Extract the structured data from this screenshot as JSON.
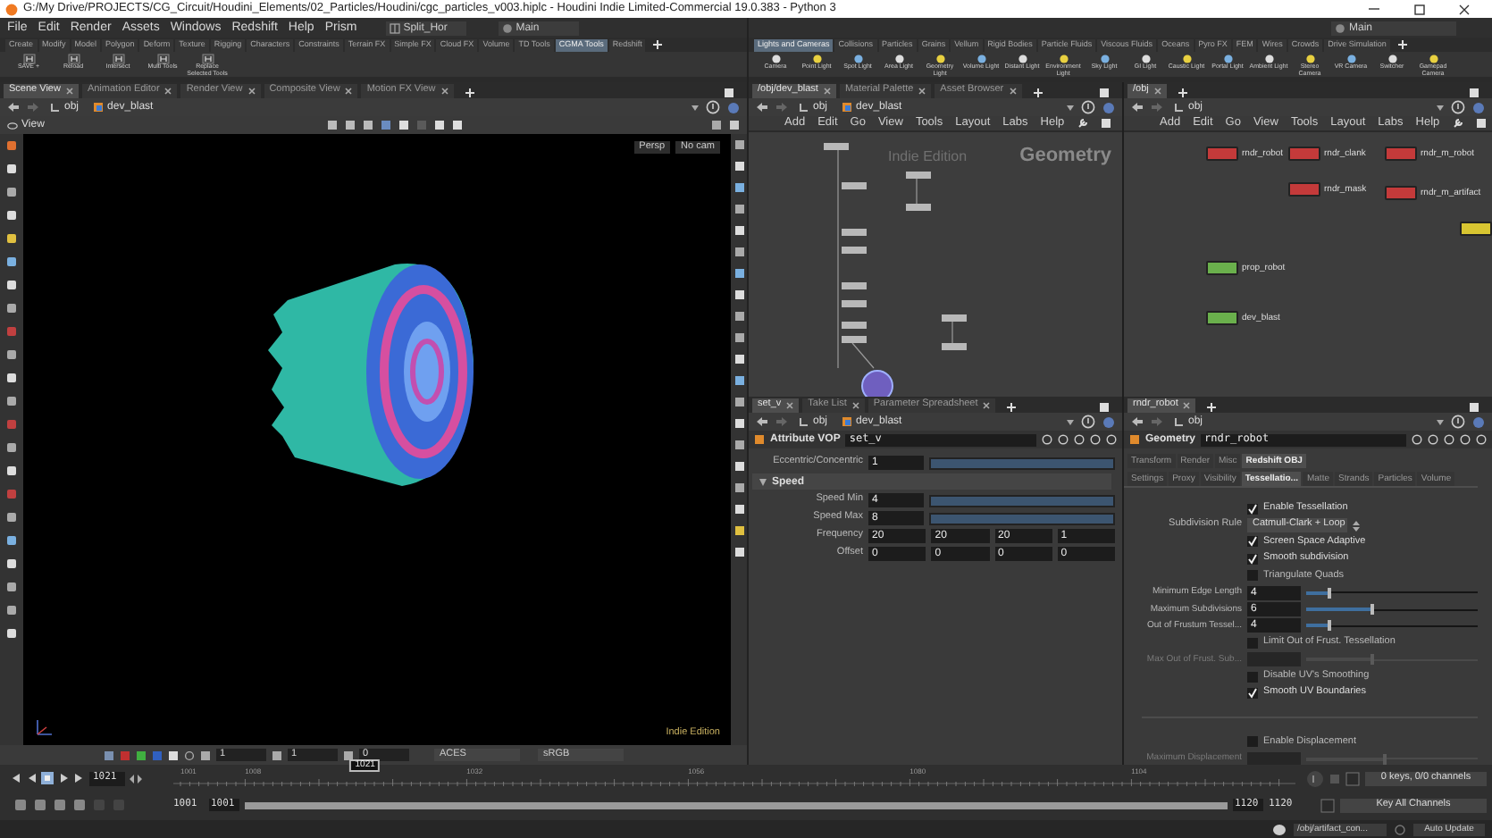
{
  "window": {
    "title": "G:/My Drive/PROJECTS/CG_Circuit/Houdini_Elements/02_Particles/Houdini/cgc_particles_v003.hiplc - Houdini Indie Limited-Commercial 19.0.383 - Python 3"
  },
  "menu": [
    "File",
    "Edit",
    "Render",
    "Assets",
    "Windows",
    "Redshift",
    "Help",
    "Prism"
  ],
  "desktop": "Split_Hor",
  "desktop_main": "Main",
  "desktop_main_right": "Main",
  "shelf_left": {
    "tabs": [
      {
        "label": "Create",
        "selected": false
      },
      {
        "label": "Modify",
        "selected": false
      },
      {
        "label": "Model",
        "selected": false
      },
      {
        "label": "Polygon",
        "selected": false
      },
      {
        "label": "Deform",
        "selected": false
      },
      {
        "label": "Texture",
        "selected": false
      },
      {
        "label": "Rigging",
        "selected": false
      },
      {
        "label": "Characters",
        "selected": false
      },
      {
        "label": "Constraints",
        "selected": false
      },
      {
        "label": "Terrain FX",
        "selected": false
      },
      {
        "label": "Simple FX",
        "selected": false
      },
      {
        "label": "Cloud FX",
        "selected": false
      },
      {
        "label": "Volume",
        "selected": false
      },
      {
        "label": "TD Tools",
        "selected": false
      },
      {
        "label": "CGMA Tools",
        "selected": true
      },
      {
        "label": "Redshift",
        "selected": false
      }
    ],
    "tools": [
      "SAVE +",
      "Reload",
      "Intersect",
      "Multi Tools",
      "Replace Selected Tools"
    ]
  },
  "shelf_right": {
    "tabs": [
      {
        "label": "Lights and Cameras",
        "selected": true
      },
      {
        "label": "Collisions",
        "selected": false
      },
      {
        "label": "Particles",
        "selected": false
      },
      {
        "label": "Grains",
        "selected": false
      },
      {
        "label": "Vellum",
        "selected": false
      },
      {
        "label": "Rigid Bodies",
        "selected": false
      },
      {
        "label": "Particle Fluids",
        "selected": false
      },
      {
        "label": "Viscous Fluids",
        "selected": false
      },
      {
        "label": "Oceans",
        "selected": false
      },
      {
        "label": "Pyro FX",
        "selected": false
      },
      {
        "label": "FEM",
        "selected": false
      },
      {
        "label": "Wires",
        "selected": false
      },
      {
        "label": "Crowds",
        "selected": false
      },
      {
        "label": "Drive Simulation",
        "selected": false
      }
    ],
    "tools": [
      "Camera",
      "Point Light",
      "Spot Light",
      "Area Light",
      "Geometry Light",
      "Volume Light",
      "Distant Light",
      "Environment Light",
      "Sky Light",
      "GI Light",
      "Caustic Light",
      "Portal Light",
      "Ambient Light",
      "Stereo Camera",
      "VR Camera",
      "Switcher",
      "Gamepad Camera"
    ]
  },
  "scene_pane": {
    "tabs": [
      {
        "label": "Scene View",
        "selected": true
      },
      {
        "label": "Animation Editor",
        "selected": false
      },
      {
        "label": "Render View",
        "selected": false
      },
      {
        "label": "Composite View",
        "selected": false
      },
      {
        "label": "Motion FX View",
        "selected": false
      }
    ],
    "path": [
      "obj",
      "dev_blast"
    ],
    "view_label": "View",
    "camera_menus": [
      "Persp",
      "No cam"
    ],
    "watermark": "Indie Edition",
    "display_fields": [
      "1",
      "1",
      "0"
    ],
    "color_space": "ACES",
    "display": "sRGB"
  },
  "network_left": {
    "tabs": [
      {
        "label": "/obj/dev_blast",
        "selected": true
      },
      {
        "label": "Material Palette",
        "selected": false
      },
      {
        "label": "Asset Browser",
        "selected": false
      }
    ],
    "path": [
      "obj",
      "dev_blast"
    ],
    "menu": [
      "Add",
      "Edit",
      "Go",
      "View",
      "Tools",
      "Layout",
      "Labs",
      "Help"
    ],
    "context_label": "Geometry",
    "watermark": "Indie Edition"
  },
  "network_right": {
    "tabs": [
      {
        "label": "/obj",
        "selected": true
      }
    ],
    "path": [
      "obj"
    ],
    "menu": [
      "Add",
      "Edit",
      "Go",
      "View",
      "Tools",
      "Layout",
      "Labs",
      "Help"
    ],
    "nodes": [
      {
        "label": "rndr_robot",
        "color": "#c43a3a"
      },
      {
        "label": "rndr_clank",
        "color": "#c43a3a"
      },
      {
        "label": "rndr_m_robot",
        "color": "#c43a3a"
      },
      {
        "label": "rndr_mask",
        "color": "#c43a3a"
      },
      {
        "label": "rndr_m_artifact",
        "color": "#c43a3a"
      },
      {
        "color": "#d8c531"
      },
      {
        "label": "prop_robot",
        "color": "#6ab04c"
      },
      {
        "label": "dev_blast",
        "color": "#6ab04c"
      }
    ]
  },
  "params_left": {
    "tabs": [
      {
        "label": "set_v",
        "selected": true
      },
      {
        "label": "Take List",
        "selected": false
      },
      {
        "label": "Parameter Spreadsheet",
        "selected": false
      }
    ],
    "path": [
      "obj",
      "dev_blast"
    ],
    "node_type": "Attribute VOP",
    "node_name": "set_v",
    "rows": [
      {
        "kind": "slider",
        "label": "Eccentric/Concentric",
        "value": "1",
        "level": 1
      },
      {
        "kind": "section",
        "label": "Speed"
      },
      {
        "kind": "slider",
        "label": "Speed Min",
        "value": "4",
        "level": 1
      },
      {
        "kind": "slider",
        "label": "Speed Max",
        "value": "8",
        "level": 1
      },
      {
        "kind": "vector",
        "label": "Frequency",
        "values": [
          "20",
          "20",
          "20",
          "1"
        ]
      },
      {
        "kind": "vector",
        "label": "Offset",
        "values": [
          "0",
          "0",
          "0",
          "0"
        ]
      }
    ]
  },
  "params_right": {
    "tabs": [
      {
        "label": "rndr_robot",
        "selected": true
      }
    ],
    "path": [
      "obj"
    ],
    "node_type": "Geometry",
    "node_name": "rndr_robot",
    "folders": [
      {
        "label": "Transform",
        "selected": false
      },
      {
        "label": "Render",
        "selected": false
      },
      {
        "label": "Misc",
        "selected": false
      },
      {
        "label": "Redshift OBJ",
        "selected": true
      }
    ],
    "subfolders": [
      {
        "label": "Settings",
        "selected": false
      },
      {
        "label": "Proxy",
        "selected": false
      },
      {
        "label": "Visibility",
        "selected": false
      },
      {
        "label": "Tessellatio...",
        "selected": true
      },
      {
        "label": "Matte",
        "selected": false
      },
      {
        "label": "Strands",
        "selected": false
      },
      {
        "label": "Particles",
        "selected": false
      },
      {
        "label": "Volume",
        "selected": false
      }
    ],
    "rows": [
      {
        "kind": "checkbox",
        "label": "Enable Tessellation",
        "checked": true
      },
      {
        "kind": "menu",
        "label": "Subdivision Rule",
        "value": "Catmull-Clark + Loop"
      },
      {
        "kind": "checkbox",
        "label": "Screen Space Adaptive",
        "checked": true
      },
      {
        "kind": "checkbox",
        "label": "Smooth subdivision",
        "checked": true
      },
      {
        "kind": "checkbox",
        "label": "Triangulate Quads",
        "checked": false
      },
      {
        "kind": "slider",
        "label": "Minimum Edge Length",
        "value": "4",
        "level": 0.12,
        "disabled": false
      },
      {
        "kind": "slider",
        "label": "Maximum Subdivisions",
        "value": "6",
        "level": 0.37,
        "disabled": false
      },
      {
        "kind": "slider",
        "label": "Out of Frustum Tessel...",
        "value": "4",
        "level": 0.12,
        "disabled": false
      },
      {
        "kind": "checkbox",
        "label": "Limit Out of Frust. Tessellation",
        "checked": false
      },
      {
        "kind": "slider",
        "label": "Max Out of Frust. Sub...",
        "level": 0.37,
        "disabled": true
      },
      {
        "kind": "checkbox",
        "label": "Disable UV's Smoothing",
        "checked": false
      },
      {
        "kind": "checkbox",
        "label": "Smooth UV Boundaries",
        "checked": true
      },
      {
        "kind": "separator"
      },
      {
        "kind": "checkbox",
        "label": "Enable Displacement",
        "checked": false
      },
      {
        "kind": "slider",
        "label": "Maximum Displacement",
        "level": 0.45,
        "disabled": true
      }
    ]
  },
  "timeline": {
    "frame": "1021",
    "frame_marker": "1021",
    "ticks": [
      "1001",
      "1008",
      "1032",
      "1056",
      "1080",
      "1104"
    ],
    "start": "1001",
    "range_start": "1001",
    "range_end": "1120",
    "end": "1120",
    "keys": "0 keys, 0/0 channels",
    "key_all": "Key All Channels"
  },
  "status_bar": {
    "path": "/obj/artifact_con...",
    "update_mode": "Auto Update"
  }
}
